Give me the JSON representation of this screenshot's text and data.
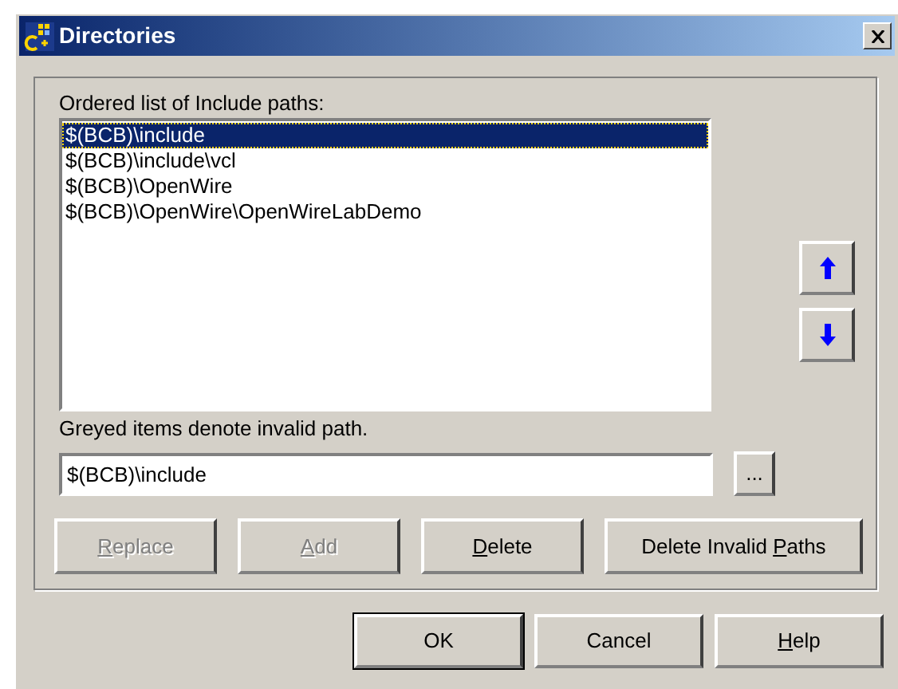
{
  "window": {
    "title": "Directories"
  },
  "list_label": "Ordered list of Include paths:",
  "paths": [
    {
      "text": "$(BCB)\\include",
      "selected": true
    },
    {
      "text": "$(BCB)\\include\\vcl",
      "selected": false
    },
    {
      "text": "$(BCB)\\OpenWire",
      "selected": false
    },
    {
      "text": "$(BCB)\\OpenWire\\OpenWireLabDemo",
      "selected": false
    }
  ],
  "hint": "Greyed items denote invalid path.",
  "path_field": {
    "value": "$(BCB)\\include"
  },
  "browse_button": "...",
  "edit_buttons": [
    {
      "label": {
        "key": "R",
        "after": "eplace"
      },
      "disabled": true
    },
    {
      "label": {
        "key": "A",
        "after": "dd"
      },
      "disabled": true
    },
    {
      "label": {
        "key": "D",
        "after": "elete"
      },
      "disabled": false
    },
    {
      "label": {
        "before": "Delete Invalid ",
        "key": "P",
        "after": "aths"
      },
      "disabled": false
    }
  ],
  "dialog_buttons": [
    {
      "label": {
        "before": "OK"
      },
      "default": true
    },
    {
      "label": {
        "before": "Cancel"
      },
      "default": false
    },
    {
      "label": {
        "key": "H",
        "after": "elp"
      },
      "default": false
    }
  ]
}
